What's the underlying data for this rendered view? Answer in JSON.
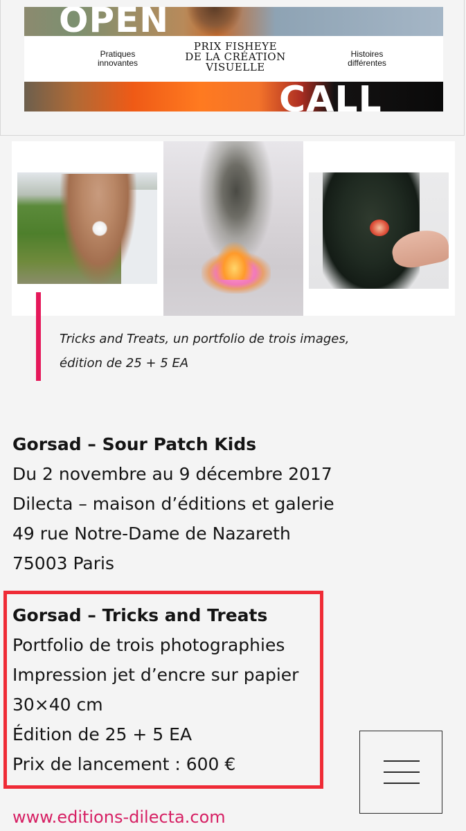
{
  "ad_banner": {
    "top_word": "OPEN",
    "bottom_word": "CALL",
    "left_text": [
      "Pratiques",
      "innovantes"
    ],
    "center_title": [
      "PRIX FISHEYE",
      "DE LA CRÉATION",
      "VISUELLE"
    ],
    "right_text": [
      "Histoires",
      "différentes"
    ]
  },
  "portfolio": {
    "caption": [
      "Tricks and Treats, un portfolio de trois images,",
      "édition de 25 + 5 EA"
    ]
  },
  "exhibition": {
    "title": "Gorsad – Sour Patch Kids",
    "lines": [
      "Du 2 novembre au 9 décembre 2017",
      "Dilecta – maison d’éditions et galerie",
      "49 rue Notre-Dame de Nazareth",
      "75003 Paris"
    ]
  },
  "product": {
    "title": "Gorsad – Tricks and Treats",
    "lines": [
      "Portfolio de trois photographies",
      "Impression jet d’encre sur papier",
      "30×40 cm",
      "Édition de 25 + 5 EA",
      "Prix de lancement : 600 €"
    ]
  },
  "link": {
    "text": "www.editions-dilecta.com"
  },
  "menu": {
    "icon": "hamburger-menu-icon"
  },
  "colors": {
    "accent": "#e5185a",
    "highlight_border": "#ef2b36",
    "link": "#d61f63"
  }
}
